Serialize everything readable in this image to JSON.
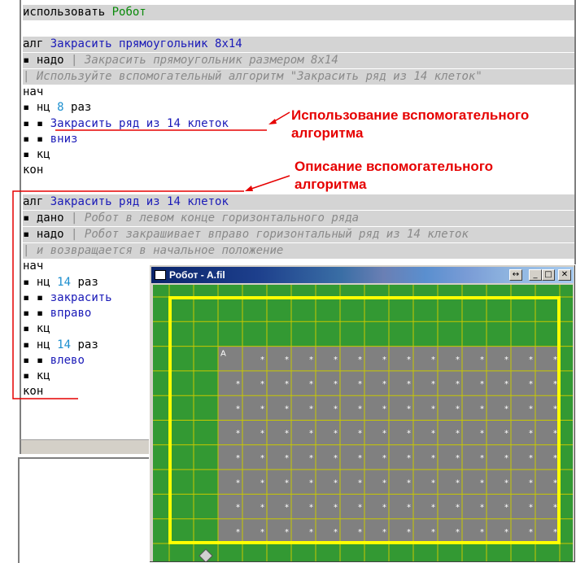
{
  "editor": {
    "use_keyword": "использовать",
    "use_target": "Робот",
    "main_alg": {
      "alg_kw": "алг",
      "name": "Закрасить прямоугольник 8x14",
      "nado_kw": "надо",
      "nado_text": "Закрасить прямоугольник размером 8x14",
      "comment": "Используйте вспомогательный алгоритм \"Закрасить ряд из 14 клеток\"",
      "nach": "нач",
      "loop_kw": "нц",
      "loop_count": "8",
      "loop_unit": "раз",
      "call": "Закрасить ряд из 14 клеток",
      "down": "вниз",
      "end_loop": "кц",
      "kon": "кон"
    },
    "helper_alg": {
      "alg_kw": "алг",
      "name": "Закрасить ряд из 14 клеток",
      "dano_kw": "дано",
      "dano_text": "Робот в левом конце горизонтального ряда",
      "nado_kw": "надо",
      "nado_text": "Робот закрашивает вправо горизонтальный ряд из 14 клеток",
      "nado_text2": "и возвращается в начальное положение",
      "nach": "нач",
      "loop_kw": "нц",
      "loop1_count": "14",
      "loop_unit": "раз",
      "paint": "закрасить",
      "right": "вправо",
      "end_loop": "кц",
      "loop2_count": "14",
      "left": "влево",
      "kon": "кон"
    },
    "bullet": "▪",
    "pipe": "|"
  },
  "annotations": {
    "usage": "Использование вспомогательного алгоритма",
    "description": "Описание вспомогательного алгоритма"
  },
  "robot_window": {
    "title": "Робот - A.fil",
    "buttons": [
      "↔",
      "_",
      "□",
      "✕"
    ],
    "grid_cols": 16,
    "grid_rows": 10,
    "painted_cols": [
      2,
      15
    ],
    "painted_rows": [
      2,
      9
    ],
    "start_label": "A",
    "star": "*",
    "colors": {
      "field": "#339933",
      "painted": "#808080",
      "grid": "#c8c800",
      "wall": "#ffff00",
      "robot": "#d0d0d0"
    }
  }
}
